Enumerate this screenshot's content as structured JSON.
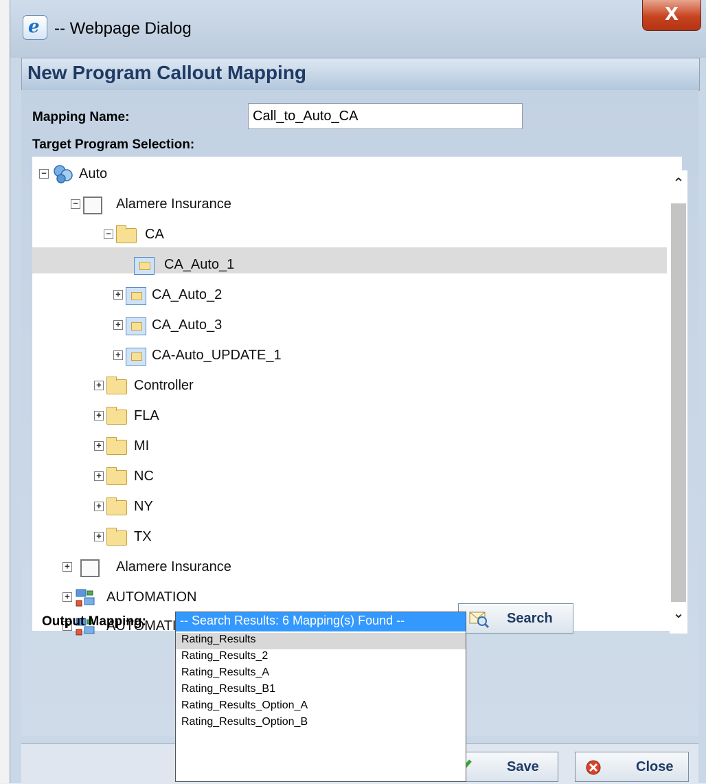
{
  "window": {
    "title": "-- Webpage Dialog",
    "close_label": "X"
  },
  "dialog": {
    "heading": "New Program Callout Mapping"
  },
  "form": {
    "mapping_name_label": "Mapping Name:",
    "mapping_name_value": "Call_to_Auto_CA",
    "target_label": "Target Program Selection:",
    "output_label": "Output Mapping:"
  },
  "tree": {
    "root": "Auto",
    "company_1": "Alamere Insurance",
    "state_ca": "CA",
    "programs": [
      "CA_Auto_1",
      "CA_Auto_2",
      "CA_Auto_3",
      "CA-Auto_UPDATE_1"
    ],
    "states": [
      "Controller",
      "FLA",
      "MI",
      "NC",
      "NY",
      "TX"
    ],
    "company_2": "Alamere Insurance",
    "products": [
      "AUTOMATION",
      "AUTOMATION"
    ],
    "selected": "CA_Auto_1"
  },
  "output_dropdown": {
    "header": "-- Search Results: 6 Mapping(s) Found --",
    "options": [
      "Rating_Results",
      "Rating_Results_2",
      "Rating_Results_A",
      "Rating_Results_B1",
      "Rating_Results_Option_A",
      "Rating_Results_Option_B"
    ],
    "highlighted": "Rating_Results"
  },
  "buttons": {
    "search": "Search",
    "save": "Save",
    "close": "Close"
  }
}
